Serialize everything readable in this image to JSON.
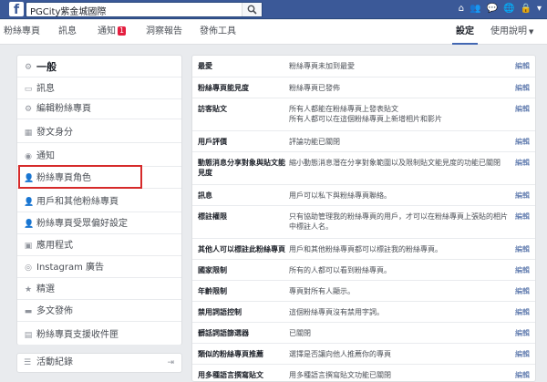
{
  "topbar": {
    "search_value": "PGCity紫金城國際",
    "right_items": [
      "⌂",
      "👥",
      "💬",
      "🌐",
      "🔒",
      "▾"
    ]
  },
  "pagenav": {
    "tabs": [
      "粉絲專頁",
      "訊息",
      "通知",
      "洞察報告",
      "發佈工具"
    ],
    "notification_count": "1",
    "settings": "設定",
    "help": "使用說明"
  },
  "sidebar": {
    "items": [
      {
        "icon": "gear-icon",
        "glyph": "⚙",
        "label": "一般"
      },
      {
        "icon": "message-icon",
        "glyph": "▭",
        "label": "訊息"
      },
      {
        "icon": "edit-icon",
        "glyph": "⚙",
        "label": "編輯粉絲專頁"
      },
      {
        "icon": "post-identity-icon",
        "glyph": "▦",
        "label": "發文身分"
      },
      {
        "icon": "globe-icon",
        "glyph": "◉",
        "label": "通知"
      },
      {
        "icon": "person-icon",
        "glyph": "👤",
        "label": "粉絲專頁角色"
      },
      {
        "icon": "people-icon",
        "glyph": "👤",
        "label": "用戶和其他粉絲專頁"
      },
      {
        "icon": "preferences-icon",
        "glyph": "👤",
        "label": "粉絲專頁受眾偏好設定"
      },
      {
        "icon": "apps-icon",
        "glyph": "▣",
        "label": "應用程式"
      },
      {
        "icon": "instagram-icon",
        "glyph": "◎",
        "label": "Instagram 廣告"
      },
      {
        "icon": "star-icon",
        "glyph": "★",
        "label": "精選"
      },
      {
        "icon": "crosspost-icon",
        "glyph": "▬",
        "label": "多文發佈"
      },
      {
        "icon": "inbox-icon",
        "glyph": "▤",
        "label": "粉絲專頁支援收件匣"
      }
    ],
    "activity_log": "活動紀錄"
  },
  "settings_rows": [
    {
      "label": "最愛",
      "desc": "粉絲專頁未加到最愛",
      "edit": "編輯"
    },
    {
      "label": "粉絲專頁能見度",
      "desc": "粉絲專頁已發佈",
      "edit": "編輯"
    },
    {
      "label": "訪客貼文",
      "desc": "所有人都能在粉絲專頁上發表貼文\n所有人都可以在這個粉絲專頁上新增相片和影片",
      "edit": "編輯"
    },
    {
      "label": "用戶評價",
      "desc": "評論功能已關閉",
      "edit": "編輯"
    },
    {
      "label": "動態消息分享對象與貼文能見度",
      "desc": "縮小動態消息潛在分享對象範圍以及限制貼文能見度的功能已關閉",
      "edit": "編輯"
    },
    {
      "label": "訊息",
      "desc": "用戶可以私下與粉絲專頁聯絡。",
      "edit": "編輯"
    },
    {
      "label": "標註權限",
      "desc": "只有協助管理我的粉絲專頁的用戶，才可以在粉絲專頁上張貼的相片中標註人名。",
      "edit": "編輯"
    },
    {
      "label": "其他人可以標註此粉絲專頁",
      "desc": "用戶和其他粉絲專頁都可以標註我的粉絲專頁。",
      "edit": "編輯"
    },
    {
      "label": "國家限制",
      "desc": "所有的人都可以看到粉絲專頁。",
      "edit": "編輯"
    },
    {
      "label": "年齡限制",
      "desc": "專頁對所有人顯示。",
      "edit": "編輯"
    },
    {
      "label": "禁用詞語控制",
      "desc": "這個粉絲專頁沒有禁用字詞。",
      "edit": "編輯"
    },
    {
      "label": "髒話詞語篩選器",
      "desc": "已關閉",
      "edit": "編輯"
    },
    {
      "label": "類似的粉絲專頁推薦",
      "desc": "選擇是否讓向他人推薦你的專頁",
      "edit": "編輯"
    },
    {
      "label": "用多種語言撰寫貼文",
      "desc": "用多種語言撰寫貼文功能已關閉",
      "edit": "編輯"
    }
  ]
}
